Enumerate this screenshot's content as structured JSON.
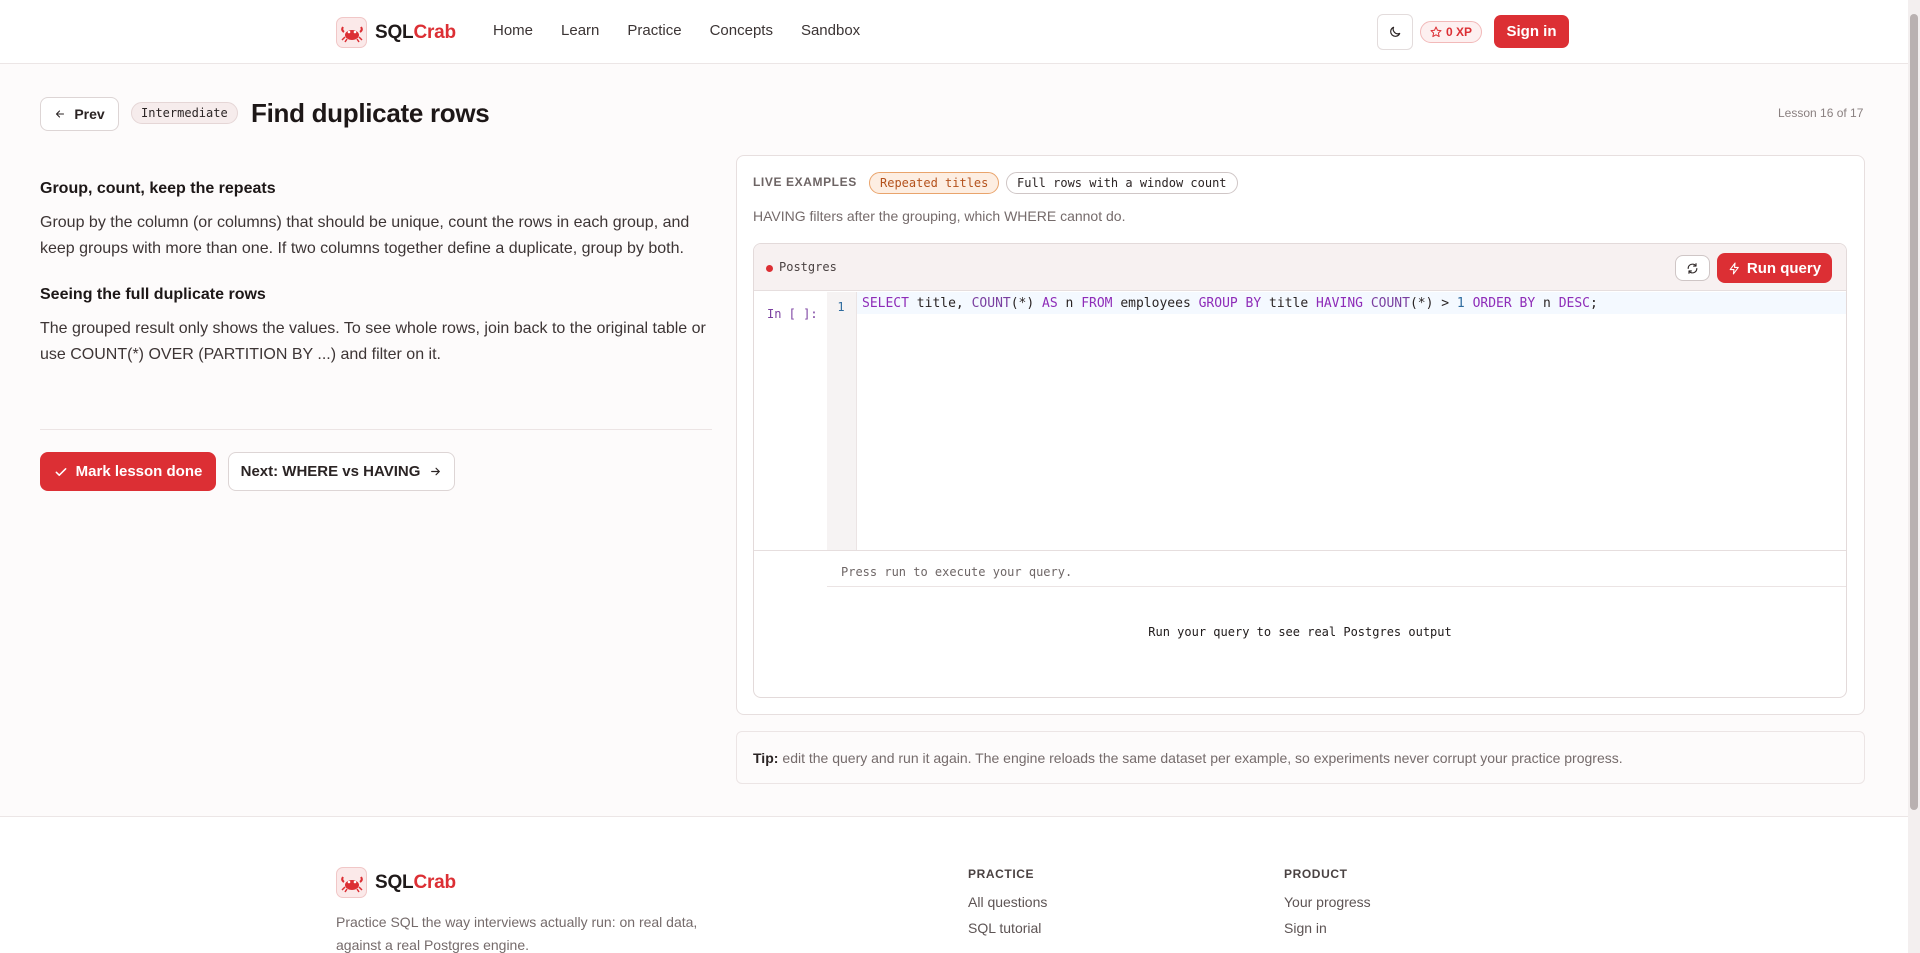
{
  "header": {
    "brand_prefix": "SQL",
    "brand_suffix": "Crab",
    "nav": [
      "Home",
      "Learn",
      "Practice",
      "Concepts",
      "Sandbox"
    ],
    "xp_label": "0 XP",
    "signin_label": "Sign in"
  },
  "lesson": {
    "prev_label": "Prev",
    "level": "Intermediate",
    "title": "Find duplicate rows",
    "progress": "Lesson 16 of 17",
    "sections": [
      {
        "heading": "Group, count, keep the repeats",
        "body": "Group by the column (or columns) that should be unique, count the rows in each group, and keep groups with more than one. If two columns together define a duplicate, group by both."
      },
      {
        "heading": "Seeing the full duplicate rows",
        "body": "The grouped result only shows the values. To see whole rows, join back to the original table or use COUNT(*) OVER (PARTITION BY ...) and filter on it."
      }
    ],
    "done_label": "Mark lesson done",
    "next_label": "Next: WHERE vs HAVING"
  },
  "examples": {
    "label": "LIVE EXAMPLES",
    "tabs": [
      {
        "label": "Repeated titles",
        "active": true
      },
      {
        "label": "Full rows with a window count",
        "active": false
      }
    ],
    "description": "HAVING filters after the grouping, which WHERE cannot do.",
    "editor": {
      "engine": "Postgres",
      "run_label": "Run query",
      "prompt": "In [ ]:",
      "line_number": "1",
      "output_hint": "Press run to execute your query.",
      "output_empty": "Run your query to see real Postgres output",
      "code": {
        "t1": "SELECT",
        "t2": " title, ",
        "t3": "COUNT",
        "t4": "(*) ",
        "t5": "AS",
        "t6": " n ",
        "t7": "FROM",
        "t8": " employees ",
        "t9": "GROUP BY",
        "t10": " title ",
        "t11": "HAVING",
        "t12": " ",
        "t13": "COUNT",
        "t14": "(*) > ",
        "t15": "1",
        "t16": " ",
        "t17": "ORDER BY",
        "t18": " n ",
        "t19": "DESC",
        "t20": ";"
      }
    }
  },
  "tip": {
    "label": "Tip:",
    "text": "edit the query and run it again. The engine reloads the same dataset per example, so experiments never corrupt your practice progress."
  },
  "footer": {
    "brand_prefix": "SQL",
    "brand_suffix": "Crab",
    "tagline": "Practice SQL the way interviews actually run: on real data, against a real Postgres engine.",
    "columns": [
      {
        "heading": "PRACTICE",
        "links": [
          "All questions",
          "SQL tutorial"
        ]
      },
      {
        "heading": "PRODUCT",
        "links": [
          "Your progress",
          "Sign in"
        ]
      }
    ]
  },
  "colors": {
    "accent": "#dc2f34",
    "tab_active": "#e9a46c"
  }
}
